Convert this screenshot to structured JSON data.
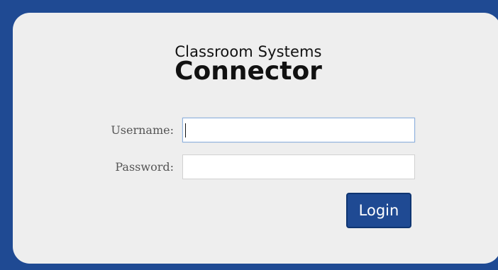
{
  "brand": {
    "subtitle": "Classroom Systems",
    "title": "Connector"
  },
  "form": {
    "username": {
      "label": "Username:",
      "value": "",
      "placeholder": ""
    },
    "password": {
      "label": "Password:",
      "value": "",
      "placeholder": ""
    },
    "login_label": "Login"
  },
  "colors": {
    "background": "#1f4a93",
    "panel": "#eeeeee",
    "button": "#1f4a93",
    "button_text": "#ffffff",
    "input_focus_border": "#8fb2de"
  }
}
